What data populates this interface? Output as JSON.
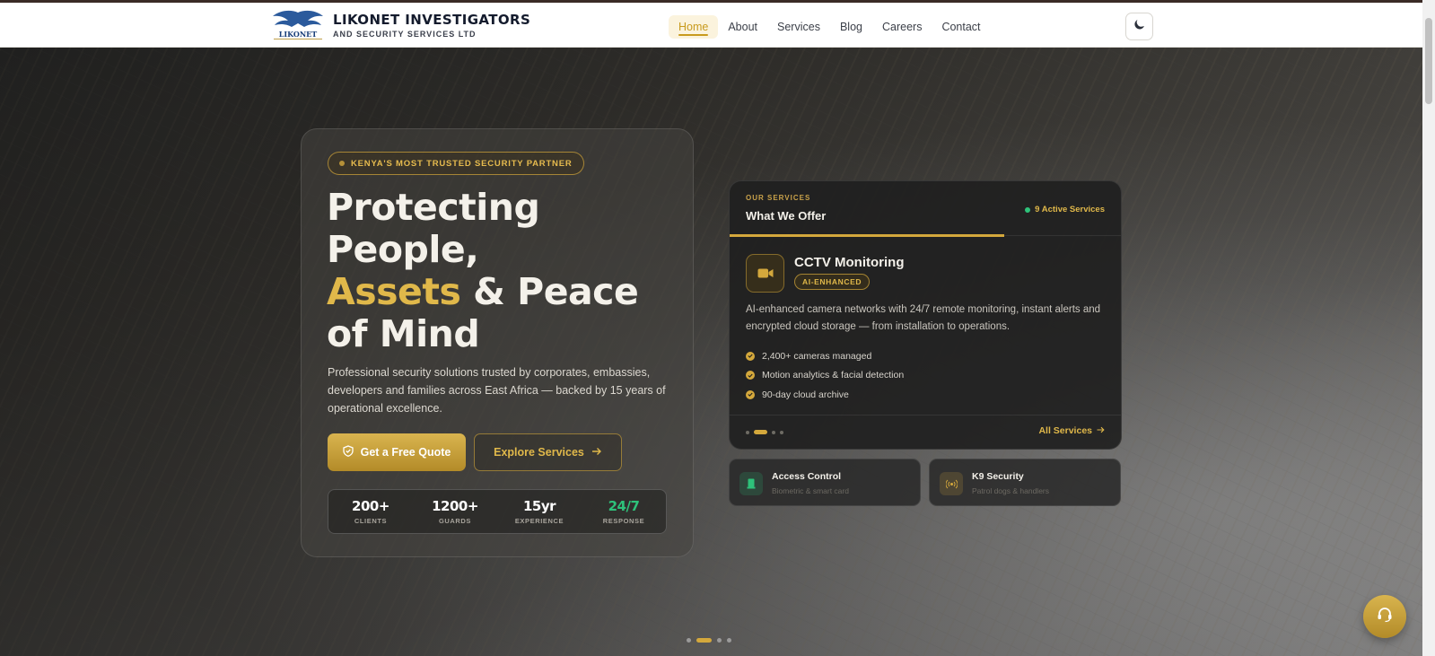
{
  "brand": {
    "name": "LIKONET INVESTIGATORS",
    "subtitle": "AND SECURITY SERVICES LTD",
    "logo_text": "LIKONET"
  },
  "nav": {
    "items": [
      {
        "label": "Home",
        "active": true
      },
      {
        "label": "About",
        "active": false
      },
      {
        "label": "Services",
        "active": false
      },
      {
        "label": "Blog",
        "active": false
      },
      {
        "label": "Careers",
        "active": false
      },
      {
        "label": "Contact",
        "active": false
      }
    ],
    "theme_toggle_icon": "moon-icon"
  },
  "hero": {
    "badge": "KENYA'S MOST TRUSTED SECURITY PARTNER",
    "headline": {
      "line1": "Protecting",
      "line2": "People,",
      "line3_gold": "Assets",
      "line3_rest": " & Peace",
      "line4": "of Mind"
    },
    "description": "Professional security solutions trusted by corporates, embassies, developers and families across East Africa — backed by 15 years of operational excellence.",
    "primary_button": "Get a Free Quote",
    "secondary_button": "Explore Services",
    "stats": [
      {
        "value": "200+",
        "label": "CLIENTS"
      },
      {
        "value": "1200+",
        "label": "GUARDS"
      },
      {
        "value": "15yr",
        "label": "EXPERIENCE"
      },
      {
        "value": "24/7",
        "label": "RESPONSE"
      }
    ],
    "slide_count": 4,
    "active_slide": 2
  },
  "services_card": {
    "eyebrow": "OUR SERVICES",
    "title": "What We Offer",
    "active_count": "9 Active Services",
    "progress": 0.7,
    "service": {
      "name": "CCTV Monitoring",
      "badge": "AI-ENHANCED",
      "icon": "video-camera-icon",
      "description": "AI-enhanced camera networks with 24/7 remote monitoring, instant alerts and encrypted cloud storage — from installation to operations.",
      "features": [
        "2,400+ cameras managed",
        "Motion analytics & facial detection",
        "90-day cloud archive"
      ]
    },
    "slide_count": 4,
    "active_slide": 2,
    "all_link": "All Services"
  },
  "mini_cards": [
    {
      "title": "Access Control",
      "subtitle": "Biometric & smart card",
      "icon": "keycard-icon",
      "color": "#2ec27a"
    },
    {
      "title": "K9 Security",
      "subtitle": "Patrol dogs & handlers",
      "icon": "broadcast-icon",
      "color": "#d4a83c"
    }
  ],
  "colors": {
    "gold": "#d4a83c",
    "green": "#2ec27a",
    "dark": "#141b2d"
  }
}
